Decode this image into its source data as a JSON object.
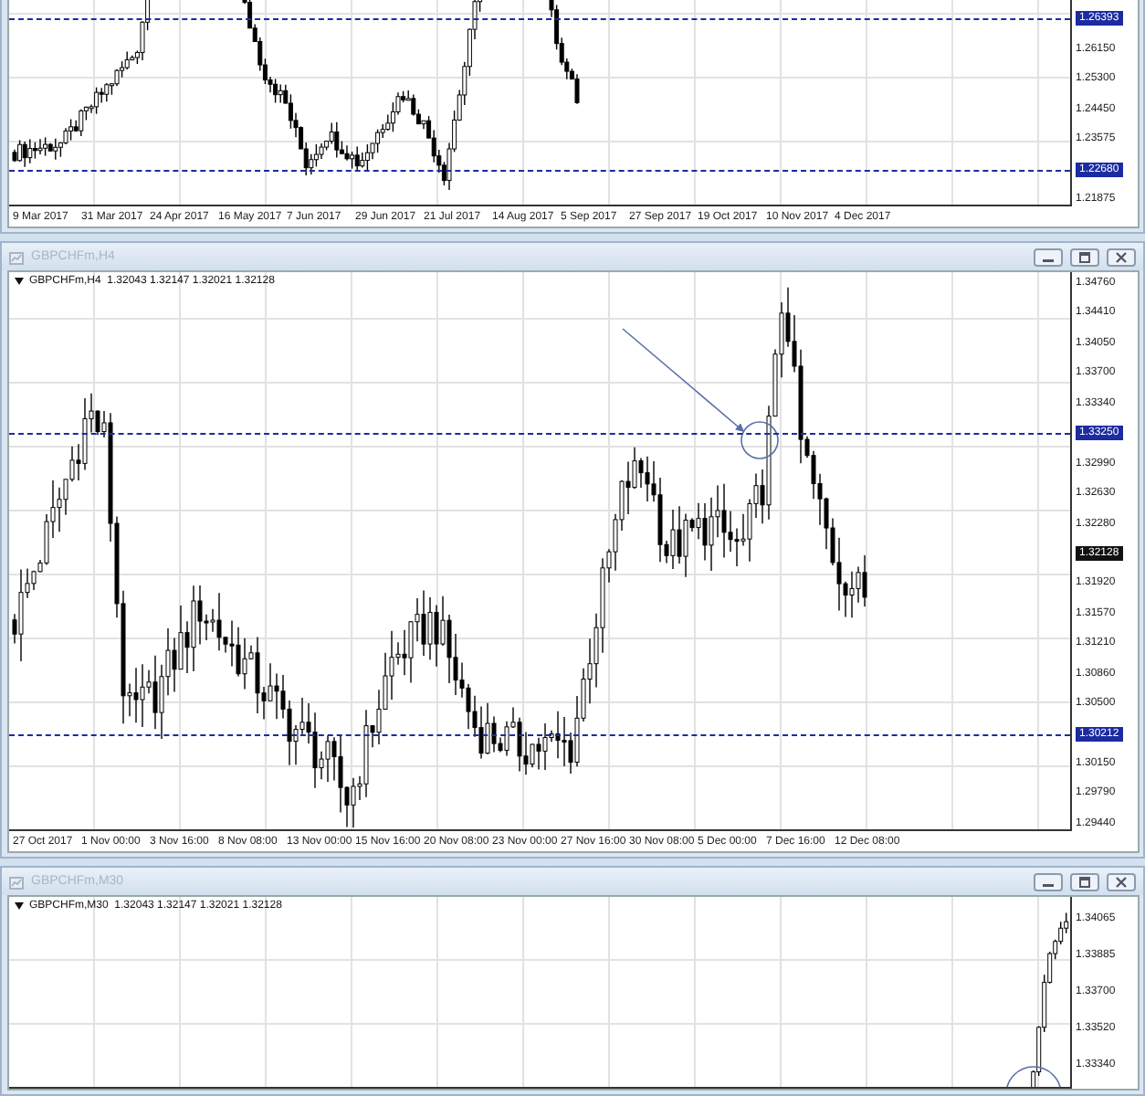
{
  "charts": [
    {
      "price_axis": [
        {
          "label": "1.26393",
          "kind": "level"
        },
        {
          "label": "1.26150",
          "kind": "tick"
        },
        {
          "label": "1.25300",
          "kind": "tick"
        },
        {
          "label": "1.24450",
          "kind": "tick"
        },
        {
          "label": "1.23575",
          "kind": "tick"
        },
        {
          "label": "1.22680",
          "kind": "level"
        },
        {
          "label": "1.21875",
          "kind": "tick"
        }
      ],
      "time_axis": [
        "9 Mar 2017",
        "31 Mar 2017",
        "24 Apr 2017",
        "16 May 2017",
        "7 Jun 2017",
        "29 Jun 2017",
        "21 Jul 2017",
        "14 Aug 2017",
        "5 Sep 2017",
        "27 Sep 2017",
        "19 Oct 2017",
        "10 Nov 2017",
        "4 Dec 2017"
      ]
    },
    {
      "title": "GBPCHFm,H4",
      "info": "GBPCHFm,H4  1.32043 1.32147 1.32021 1.32128",
      "price_axis": [
        {
          "label": "1.34760",
          "kind": "tick"
        },
        {
          "label": "1.34410",
          "kind": "tick"
        },
        {
          "label": "1.34050",
          "kind": "tick"
        },
        {
          "label": "1.33700",
          "kind": "tick"
        },
        {
          "label": "1.33340",
          "kind": "tick"
        },
        {
          "label": "1.33250",
          "kind": "level"
        },
        {
          "label": "1.32990",
          "kind": "tick"
        },
        {
          "label": "1.32630",
          "kind": "tick"
        },
        {
          "label": "1.32280",
          "kind": "tick"
        },
        {
          "label": "1.32128",
          "kind": "price"
        },
        {
          "label": "1.31920",
          "kind": "tick"
        },
        {
          "label": "1.31570",
          "kind": "tick"
        },
        {
          "label": "1.31210",
          "kind": "tick"
        },
        {
          "label": "1.30860",
          "kind": "tick"
        },
        {
          "label": "1.30500",
          "kind": "tick"
        },
        {
          "label": "1.30212",
          "kind": "level"
        },
        {
          "label": "1.30150",
          "kind": "tick"
        },
        {
          "label": "1.29790",
          "kind": "tick"
        },
        {
          "label": "1.29440",
          "kind": "tick"
        }
      ],
      "time_axis": [
        "27 Oct 2017",
        "1 Nov 00:00",
        "3 Nov 16:00",
        "8 Nov 08:00",
        "13 Nov 00:00",
        "15 Nov 16:00",
        "20 Nov 08:00",
        "23 Nov 00:00",
        "27 Nov 16:00",
        "30 Nov 08:00",
        "5 Dec 00:00",
        "7 Dec 16:00",
        "12 Dec 08:00"
      ]
    },
    {
      "title": "GBPCHFm,M30",
      "info": "GBPCHFm,M30  1.32043 1.32147 1.32021 1.32128",
      "price_axis": [
        {
          "label": "1.34065",
          "kind": "tick"
        },
        {
          "label": "1.33885",
          "kind": "tick"
        },
        {
          "label": "1.33700",
          "kind": "tick"
        },
        {
          "label": "1.33520",
          "kind": "tick"
        },
        {
          "label": "1.33340",
          "kind": "tick"
        }
      ]
    }
  ]
}
